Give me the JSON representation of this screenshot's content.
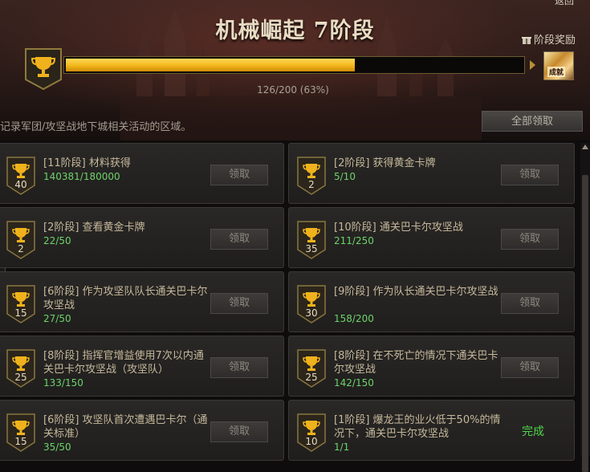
{
  "header": {
    "top_right_label": "返回",
    "title": "机械崛起 7阶段",
    "reward_label": "阶段奖励",
    "reward_item_label": "成就",
    "progress": {
      "current": 126,
      "total": 200,
      "percent": 63,
      "text": "126/200 (63%)"
    },
    "description": "记录军团/攻坚战地下城相关活动的区域。",
    "claim_all_label": "全部领取"
  },
  "colors": {
    "bar": "#f2b61b",
    "progress_green": "#6dd36a",
    "done_green": "#4fd54a"
  },
  "quests": [
    {
      "badge": "40",
      "name": "[11阶段] 材料获得",
      "progress": "140381/180000",
      "button": "领取"
    },
    {
      "badge": "2",
      "name": "[2阶段] 获得黄金卡牌",
      "progress": "5/10",
      "button": "领取"
    },
    {
      "badge": "2",
      "name": "[2阶段] 查看黄金卡牌",
      "progress": "22/50",
      "button": "领取"
    },
    {
      "badge": "35",
      "name": "[10阶段] 通关巴卡尔攻坚战",
      "progress": "211/250",
      "button": "领取"
    },
    {
      "badge": "15",
      "name": "[6阶段] 作为攻坚队队长通关巴卡尔攻坚战",
      "progress": "27/50",
      "button": "领取"
    },
    {
      "badge": "30",
      "name": "[9阶段] 作为队长通关巴卡尔攻坚战",
      "progress": "158/200",
      "button": "领取"
    },
    {
      "badge": "25",
      "name": "[8阶段] 指挥官增益使用7次以内通关巴卡尔攻坚战（攻坚队）",
      "progress": "133/150",
      "button": "领取"
    },
    {
      "badge": "25",
      "name": "[8阶段] 在不死亡的情况下通关巴卡尔攻坚战",
      "progress": "142/150",
      "button": "领取"
    },
    {
      "badge": "15",
      "name": "[6阶段] 攻坚队首次遭遇巴卡尔（通关标准）",
      "progress": "35/50",
      "button": "领取"
    },
    {
      "badge": "10",
      "name": "[1阶段] 爆龙王的业火低于50%的情况下，通关巴卡尔攻坚战",
      "progress": "1/1",
      "status": "完成"
    }
  ]
}
